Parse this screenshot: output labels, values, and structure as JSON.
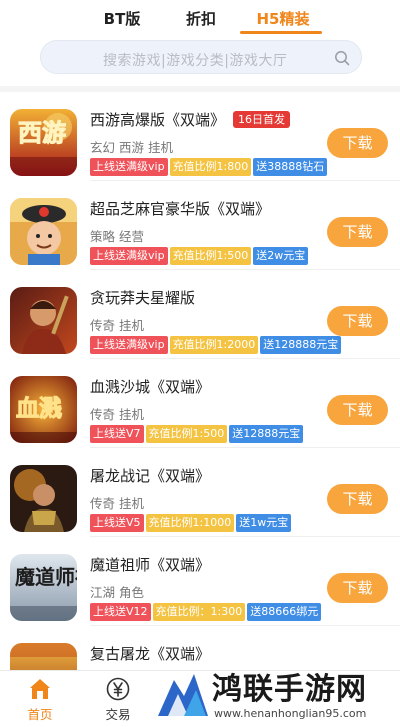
{
  "tabs": [
    {
      "label": "BT版",
      "active": false
    },
    {
      "label": "折扣",
      "active": false
    },
    {
      "label": "H5精装",
      "active": true
    }
  ],
  "search": {
    "placeholder": "搜索游戏|游戏分类|游戏大厅"
  },
  "games": [
    {
      "name": "西游高爆版《双端》",
      "badge": "16日首发",
      "cats": "玄幻  西游  挂机",
      "tags": [
        "上线送满级vip",
        "充值比例1:800",
        "送38888钻石"
      ],
      "button": "下载",
      "icon": "xiyou-game-icon",
      "icon_text": "西游"
    },
    {
      "name": "超品芝麻官豪华版《双端》",
      "badge": "",
      "cats": "策略  经营",
      "tags": [
        "上线送满级vip",
        "充值比例1:500",
        "送2w元宝"
      ],
      "button": "下载",
      "icon": "zhimaguan-game-icon",
      "icon_text": ""
    },
    {
      "name": "贪玩莽夫星耀版",
      "badge": "",
      "cats": "传奇  挂机",
      "tags": [
        "上线送满级vip",
        "充值比例1:2000",
        "送128888元宝"
      ],
      "button": "下载",
      "icon": "mangfu-game-icon",
      "icon_text": ""
    },
    {
      "name": "血溅沙城《双端》",
      "badge": "",
      "cats": "传奇  挂机",
      "tags": [
        "上线送V7",
        "充值比例1:500",
        "送12888元宝"
      ],
      "button": "下载",
      "icon": "xuejian-game-icon",
      "icon_text": "血溅"
    },
    {
      "name": "屠龙战记《双端》",
      "badge": "",
      "cats": "传奇  挂机",
      "tags": [
        "上线送V5",
        "充值比例1:1000",
        "送1w元宝"
      ],
      "button": "下载",
      "icon": "tulong-game-icon",
      "icon_text": ""
    },
    {
      "name": "魔道祖师《双端》",
      "badge": "",
      "cats": "江湖  角色",
      "tags": [
        "上线送V12",
        "充值比例：1:300",
        "送88666绑元"
      ],
      "button": "下载",
      "icon": "modao-game-icon",
      "icon_text": "魔道师祖"
    },
    {
      "name": "复古屠龙《双端》",
      "badge": "",
      "cats": "",
      "tags": [],
      "button": "",
      "icon": "fugu-game-icon",
      "icon_text": ""
    }
  ],
  "bottom_nav": [
    {
      "label": "首页",
      "icon": "home-icon",
      "active": true
    },
    {
      "label": "交易",
      "icon": "yen-icon",
      "active": false
    }
  ],
  "watermark": {
    "text": "鸿联手游网",
    "url": "www.henanhonglian95.com"
  },
  "colors": {
    "accent": "#f0851a",
    "button": "#f8a53d",
    "badge": "#e53935",
    "tag_red": "#f0525a",
    "tag_yellow": "#f5c342",
    "tag_blue": "#3f8de5"
  }
}
